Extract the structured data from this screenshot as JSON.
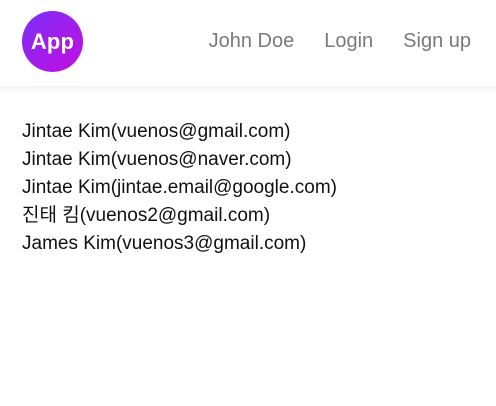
{
  "header": {
    "logo_text": "App",
    "nav": {
      "user_name": "John Doe",
      "login_label": "Login",
      "signup_label": "Sign up"
    }
  },
  "colors": {
    "logo_gradient_start": "#7b2ff7",
    "logo_gradient_end": "#c40ee0",
    "nav_text": "#7a7a7a",
    "body_text": "#111111"
  },
  "users": [
    {
      "label": "Jintae Kim(vuenos@gmail.com)"
    },
    {
      "label": "Jintae Kim(vuenos@naver.com)"
    },
    {
      "label": "Jintae Kim(jintae.email@google.com)"
    },
    {
      "label": "진태 킴(vuenos2@gmail.com)"
    },
    {
      "label": "James Kim(vuenos3@gmail.com)"
    }
  ]
}
